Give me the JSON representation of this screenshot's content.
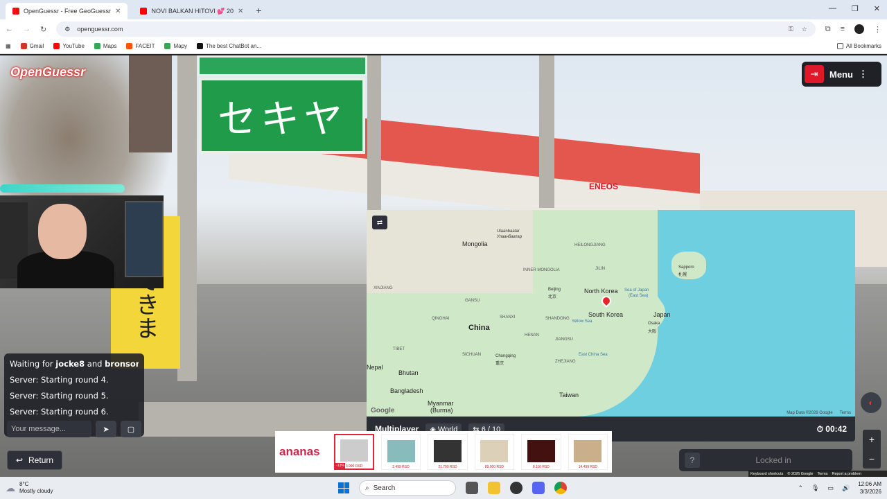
{
  "browser": {
    "tabs": [
      {
        "label": "OpenGuessr - Free GeoGuessr",
        "active": true
      },
      {
        "label": "NOVI BALKAN HITOVI 💕 20",
        "active": false
      }
    ],
    "url": "openguessr.com",
    "bookmarks": [
      "Gmail",
      "YouTube",
      "Maps",
      "FACEIT",
      "Mapy",
      "The best ChatBot an...",
      "All Bookmarks"
    ]
  },
  "game": {
    "logo": "OpenGuessr",
    "menu_label": "Menu",
    "mode": "Multiplayer",
    "map_scope": "World",
    "round": "6 / 10",
    "timer": "00:42",
    "locked_label": "Locked in",
    "return_label": "Return"
  },
  "chat": {
    "waiting_prefix": "Waiting for",
    "player1": "jocke8",
    "and": "and",
    "player2": "bronson....",
    "messages": [
      "Server: Starting round 4.",
      "Server: Starting round 5.",
      "Server: Starting round 6."
    ],
    "placeholder": "Your message..."
  },
  "map": {
    "labels": {
      "mongolia": "Mongolia",
      "ulaanbaatar": "Ulaanbaatar",
      "ulaanbaatar_cyr": "Улаанбаатар",
      "heilongjiang": "HEILONGJIANG",
      "jilin": "JILIN",
      "inner_mongolia": "INNER MONGOLIA",
      "north_korea": "North Korea",
      "south_korea": "South Korea",
      "sapporo": "Sapporo",
      "sapporo_jp": "札幌",
      "sea_of_japan": "Sea of Japan",
      "east_sea": "(East Sea)",
      "japan": "Japan",
      "osaka": "Osaka",
      "osaka_jp": "大阪",
      "beijing": "Beijing",
      "beijing_cn": "北京",
      "xinjiang": "XINJIANG",
      "gansu": "GANSU",
      "qinghai": "QINGHAI",
      "shanxi": "SHANXI",
      "shandong": "SHANDONG",
      "china": "China",
      "yellow_sea": "Yellow Sea",
      "henan": "HENAN",
      "jiangsu": "JIANGSU",
      "tibet": "TIBET",
      "sichuan": "SICHUAN",
      "chongqing": "Chongqing",
      "chongqing_cn": "重庆",
      "zhejiang": "ZHEJIANG",
      "east_china_sea": "East China Sea",
      "nepal": "Nepal",
      "bhutan": "Bhutan",
      "bangladesh": "Bangladesh",
      "myanmar": "Myanmar",
      "burma": "(Burma)",
      "taiwan": "Taiwan",
      "google": "Google",
      "map_data": "Map Data ©2026 Google",
      "terms": "Terms"
    }
  },
  "ad": {
    "brand": "ananas",
    "discount": "-13%",
    "prices": [
      "3.990 RSD",
      "2.499 RSD",
      "21.799 RSD",
      "89.000 RSD",
      "8.110 RSD",
      "14.499 RSD"
    ]
  },
  "street_footer": [
    "Keyboard shortcuts",
    "© 2026 Google",
    "Terms",
    "Report a problem"
  ],
  "taskbar": {
    "temp": "8°C",
    "weather": "Mostly cloudy",
    "search": "Search",
    "time": "12:06 AM",
    "date": "3/3/2026"
  },
  "scene": {
    "sign_text": "セキヤ",
    "banner_text": "払できま",
    "eneos": "ENEOS"
  }
}
